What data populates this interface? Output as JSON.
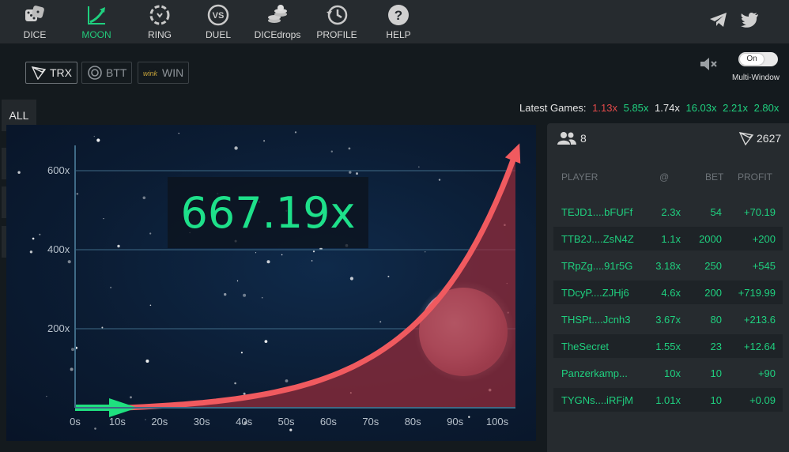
{
  "nav": [
    {
      "label": "DICE",
      "icon": "dice-icon",
      "active": false
    },
    {
      "label": "MOON",
      "icon": "moon-chart-icon",
      "active": true
    },
    {
      "label": "RING",
      "icon": "ring-icon",
      "active": false
    },
    {
      "label": "DUEL",
      "icon": "versus-icon",
      "active": false
    },
    {
      "label": "DICEdrops",
      "icon": "coins-icon",
      "active": false
    },
    {
      "label": "PROFILE",
      "icon": "history-icon",
      "active": false
    },
    {
      "label": "HELP",
      "icon": "help-icon",
      "active": false
    }
  ],
  "social": [
    "telegram-icon",
    "twitter-icon"
  ],
  "currencies": [
    {
      "label": "TRX",
      "icon": "tron-icon",
      "active": true
    },
    {
      "label": "BTT",
      "icon": "bittorrent-icon",
      "active": false
    },
    {
      "label": "WIN",
      "icon": "wink-icon",
      "active": false
    }
  ],
  "controls": {
    "toggle_label": "On",
    "multi_window_label": "Multi-Window",
    "mute_icon": "mute-icon"
  },
  "latest_games": {
    "label": "Latest Games:",
    "values": [
      {
        "text": "1.13x",
        "color": "#e34a4a"
      },
      {
        "text": "5.85x",
        "color": "#1fd07f"
      },
      {
        "text": "1.74x",
        "color": "#e8e8e8"
      },
      {
        "text": "16.03x",
        "color": "#1fd07f"
      },
      {
        "text": "2.21x",
        "color": "#1fd07f"
      },
      {
        "text": "2.80x",
        "color": "#1fd07f"
      }
    ]
  },
  "sidebar": {
    "all_label": "ALL",
    "icons": [
      "headset-icon",
      "bell-icon",
      "clipboard-icon"
    ]
  },
  "game": {
    "multiplier": "667.19x"
  },
  "chart_data": {
    "type": "area",
    "x_ticks": [
      "0s",
      "10s",
      "20s",
      "30s",
      "40s",
      "50s",
      "60s",
      "70s",
      "80s",
      "90s",
      "100s"
    ],
    "y_ticks": [
      "200x",
      "400x",
      "600x"
    ],
    "xlim": [
      0,
      100
    ],
    "ylim": [
      0,
      667.19
    ],
    "current": 667.19,
    "grid": true
  },
  "players_panel": {
    "player_count": "8",
    "pool": "2627",
    "headers": {
      "player": "PLAYER",
      "at": "@",
      "bet": "BET",
      "profit": "PROFIT"
    },
    "rows": [
      {
        "player": "TEJD1....bFUFf",
        "at": "2.3x",
        "bet": "54",
        "profit": "+70.19"
      },
      {
        "player": "TTB2J....ZsN4Z",
        "at": "1.1x",
        "bet": "2000",
        "profit": "+200"
      },
      {
        "player": "TRpZg....91r5G",
        "at": "3.18x",
        "bet": "250",
        "profit": "+545"
      },
      {
        "player": "TDcyP....ZJHj6",
        "at": "4.6x",
        "bet": "200",
        "profit": "+719.99"
      },
      {
        "player": "THSPt....Jcnh3",
        "at": "3.67x",
        "bet": "80",
        "profit": "+213.6"
      },
      {
        "player": "TheSecret",
        "at": "1.55x",
        "bet": "23",
        "profit": "+12.64"
      },
      {
        "player": "Panzerkamp...",
        "at": "10x",
        "bet": "10",
        "profit": "+90"
      },
      {
        "player": "TYGNs....iRFjM",
        "at": "1.01x",
        "bet": "10",
        "profit": "+0.09"
      }
    ]
  }
}
